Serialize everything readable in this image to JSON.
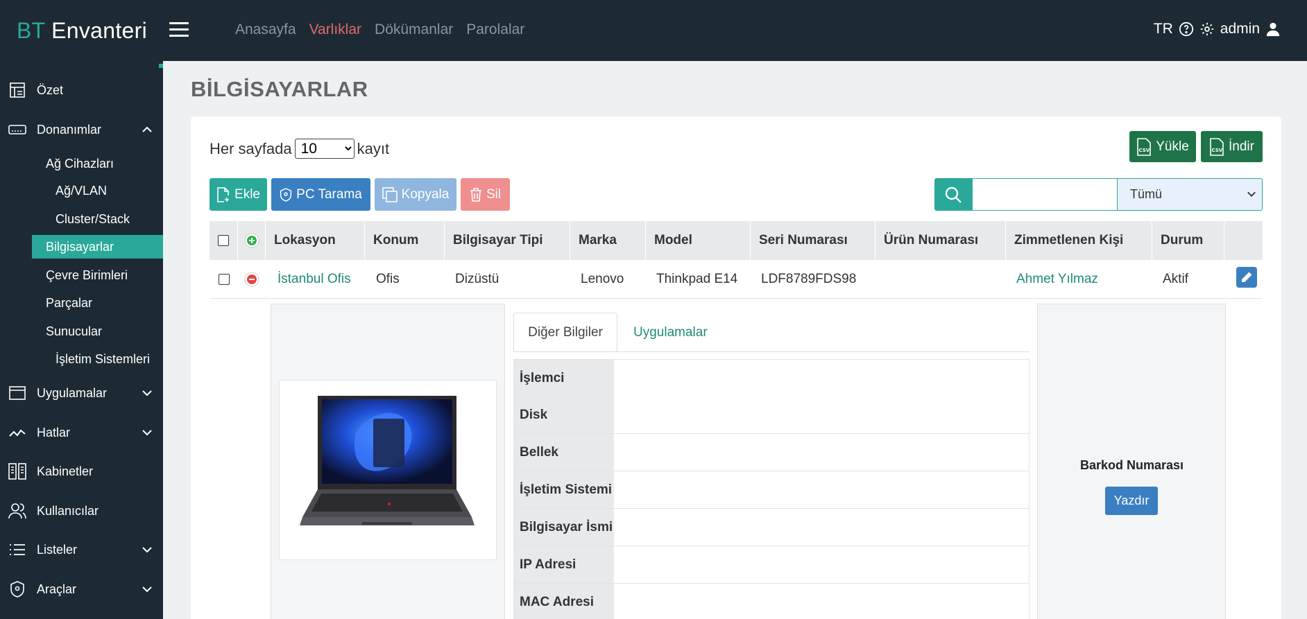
{
  "brand": {
    "prefix": "BT",
    "name": "Envanteri"
  },
  "topnav": [
    {
      "label": "Anasayfa",
      "active": false
    },
    {
      "label": "Varlıklar",
      "active": true
    },
    {
      "label": "Dökümanlar",
      "active": false
    },
    {
      "label": "Parolalar",
      "active": false
    }
  ],
  "topright": {
    "lang": "TR",
    "user": "admin"
  },
  "sidebar": {
    "items": [
      {
        "label": "Özet",
        "icon": "dashboard-icon"
      },
      {
        "label": "Donanımlar",
        "icon": "hardware-icon"
      },
      {
        "label": "Uygulamalar",
        "icon": "window-icon"
      },
      {
        "label": "Hatlar",
        "icon": "chart-line-icon"
      },
      {
        "label": "Kabinetler",
        "icon": "cabinet-icon"
      },
      {
        "label": "Kullanıcılar",
        "icon": "users-icon"
      },
      {
        "label": "Listeler",
        "icon": "list-icon"
      },
      {
        "label": "Araçlar",
        "icon": "shield-icon"
      }
    ],
    "subitems": [
      {
        "label": "Ağ Cihazları"
      },
      {
        "label": "Ağ/VLAN"
      },
      {
        "label": "Cluster/Stack"
      },
      {
        "label": "Bilgisayarlar",
        "active": true
      },
      {
        "label": "Çevre Birimleri"
      },
      {
        "label": "Parçalar"
      },
      {
        "label": "Sunucular"
      },
      {
        "label": "İşletim Sistemleri"
      }
    ]
  },
  "page": {
    "title": "BİLGİSAYARLAR"
  },
  "controls": {
    "per_page_prefix": "Her sayfada",
    "per_page_value": "10",
    "per_page_suffix": "kayıt",
    "upload_label": "Yükle",
    "download_label": "İndir",
    "add_label": "Ekle",
    "scan_label": "PC Tarama",
    "copy_label": "Kopyala",
    "delete_label": "Sil",
    "search_value": "",
    "filter_value": "Tümü"
  },
  "table": {
    "columns": [
      "Lokasyon",
      "Konum",
      "Bilgisayar Tipi",
      "Marka",
      "Model",
      "Seri Numarası",
      "Ürün Numarası",
      "Zimmetlenen Kişi",
      "Durum"
    ],
    "rows": [
      {
        "lokasyon": "İstanbul Ofis",
        "konum": "Ofis",
        "tip": "Dizüstü",
        "marka": "Lenovo",
        "model": "Thinkpad E14",
        "seri": "LDF8789FDS98",
        "urun": "",
        "kisi": "Ahmet Yılmaz",
        "durum": "Aktif"
      }
    ]
  },
  "detail": {
    "tabs": [
      "Diğer Bilgiler",
      "Uygulamalar"
    ],
    "fields": [
      {
        "label": "İşlemci",
        "value": ""
      },
      {
        "label": "Disk",
        "value": ""
      },
      {
        "label": "Bellek",
        "value": ""
      },
      {
        "label": "İşletim Sistemi",
        "value": ""
      },
      {
        "label": "Bilgisayar İsmi",
        "value": ""
      },
      {
        "label": "IP Adresi",
        "value": ""
      },
      {
        "label": "MAC Adresi",
        "value": ""
      }
    ],
    "barcode_label": "Barkod Numarası",
    "print_label": "Yazdır"
  },
  "colors": {
    "accent": "#2aa89a",
    "sidebar": "#1d2a33",
    "active_nav": "#e06a6a",
    "primary_blue": "#3a7fc1",
    "dark_green": "#1e7448"
  }
}
